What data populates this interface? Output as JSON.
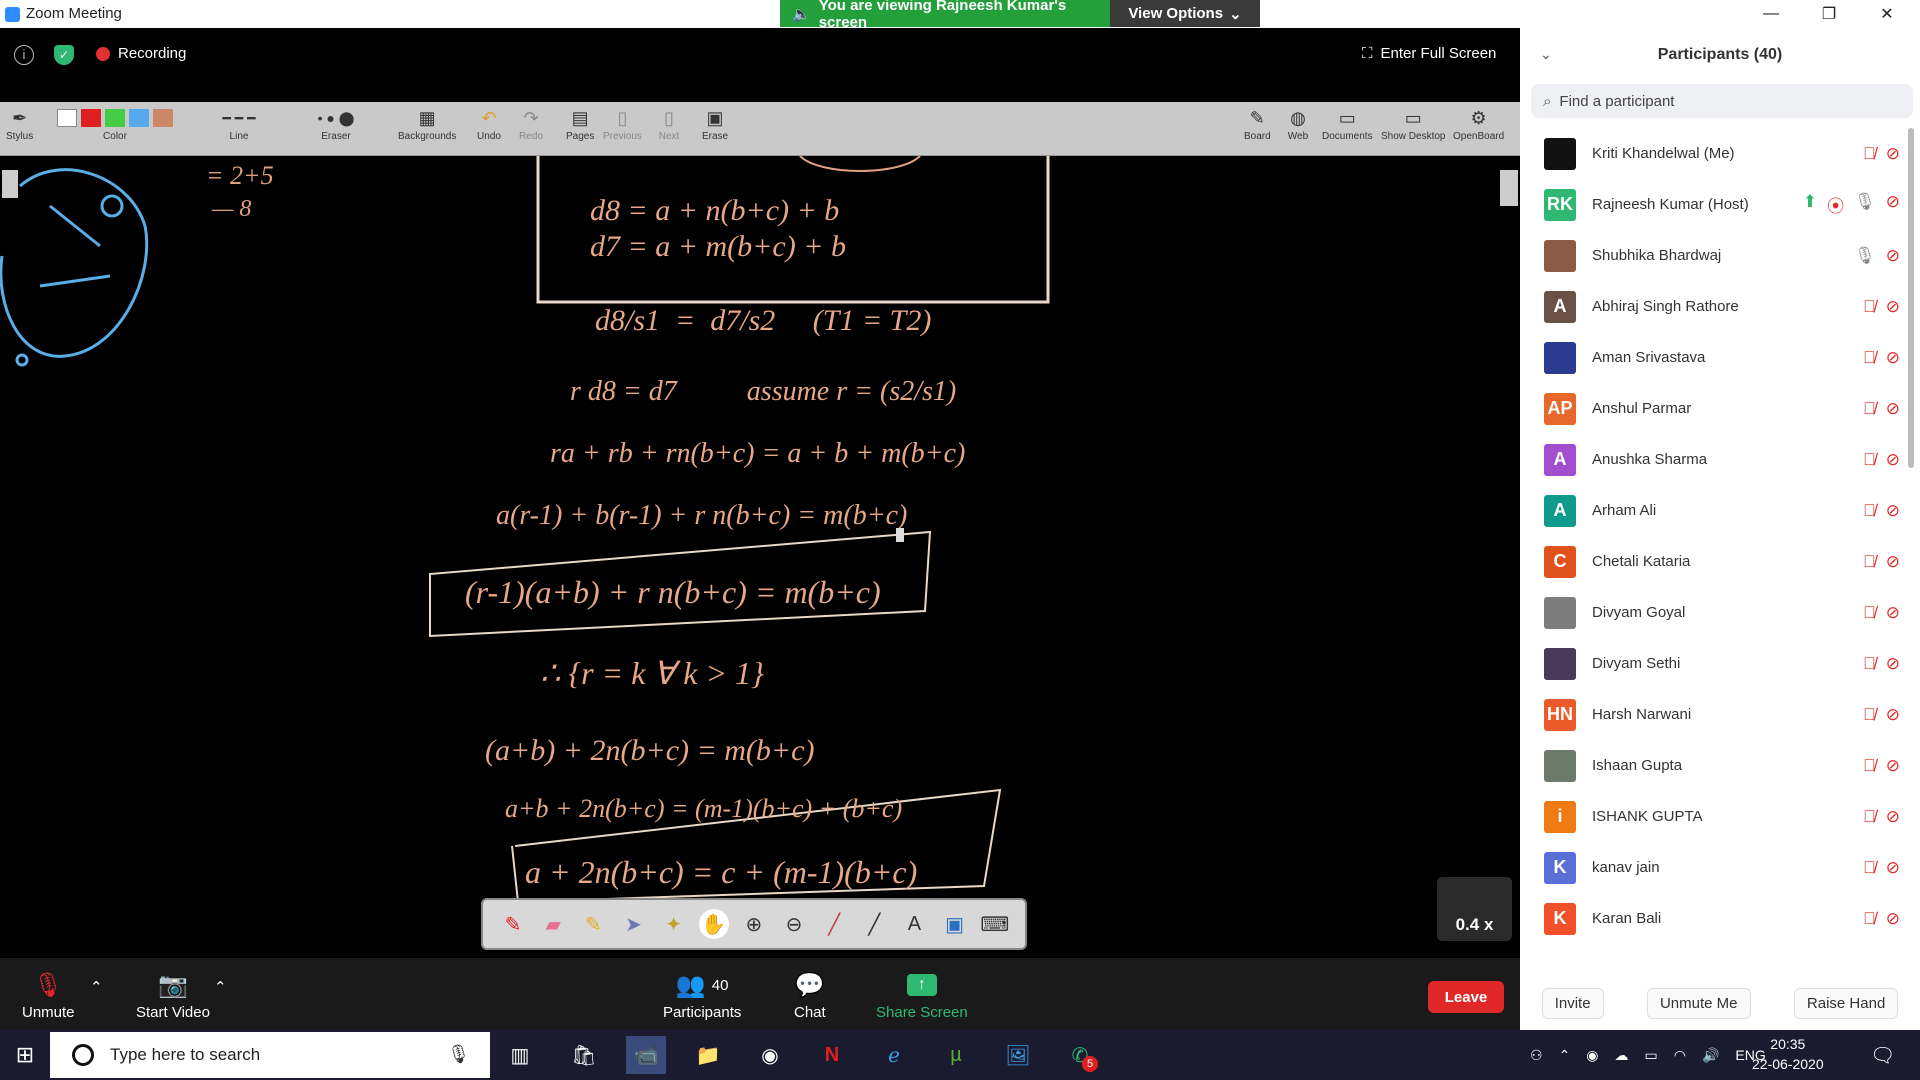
{
  "window": {
    "title": "Zoom Meeting",
    "viewing_banner": "You are viewing Rajneesh Kumar's screen",
    "view_options": "View Options"
  },
  "share_top": {
    "recording": "Recording",
    "full_screen": "Enter Full Screen"
  },
  "whiteboard_toolbar": {
    "left_tools": [
      {
        "label": "Stylus",
        "icon": "stylus-icon"
      },
      {
        "label": "Color",
        "icon": "color-swatches"
      },
      {
        "label": "Line",
        "icon": "line-width-icon"
      },
      {
        "label": "Eraser",
        "icon": "eraser-size-icon"
      },
      {
        "label": "Backgrounds",
        "icon": "backgrounds-icon"
      },
      {
        "label": "Undo",
        "icon": "undo-icon"
      },
      {
        "label": "Redo",
        "icon": "redo-icon"
      },
      {
        "label": "Pages",
        "icon": "pages-icon"
      },
      {
        "label": "Previous",
        "icon": "previous-icon"
      },
      {
        "label": "Next",
        "icon": "next-icon"
      },
      {
        "label": "Erase",
        "icon": "erase-icon"
      }
    ],
    "right_tools": [
      {
        "label": "Board",
        "icon": "board-icon"
      },
      {
        "label": "Web",
        "icon": "globe-icon"
      },
      {
        "label": "Documents",
        "icon": "folder-icon"
      },
      {
        "label": "Show Desktop",
        "icon": "desktop-icon"
      },
      {
        "label": "OpenBoard",
        "icon": "gear-icon"
      }
    ],
    "colors": [
      "#ffffff",
      "#e02020",
      "#44cc44",
      "#55aaee",
      "#cc8866"
    ]
  },
  "whiteboard": {
    "lines": [
      "d8 = a + n(b+c) + b",
      "d7 = a + m(b+c) + b",
      "d8/s1  =  d7/s2     (T1 = T2)",
      "r d8 = d7          assume r = (s2/s1)",
      "ra + rb + rn(b+c) = a + b + m(b+c)",
      "a(r-1) + b(r-1) + r n(b+c) = m(b+c)",
      "(r-1)(a+b) + r n(b+c) = m(b+c)",
      "∴ {r = k ∀ k > 1}",
      "(a+b) + 2n(b+c) = m(b+c)",
      "a+b + 2n(b+c) = (m-1)(b+c) + (b+c)",
      "a + 2n(b+c) = c + (m-1)(b+c)"
    ],
    "zoom_level": "0.4 x"
  },
  "pen_tools": [
    "pen-icon",
    "eraser-icon",
    "highlighter-icon",
    "pointer-icon",
    "laser-icon",
    "hand-icon",
    "zoom-in-icon",
    "zoom-out-icon",
    "marker-icon",
    "line-icon",
    "text-icon",
    "capture-icon",
    "keyboard-icon"
  ],
  "meeting_bar": {
    "unmute": "Unmute",
    "start_video": "Start Video",
    "participants": "Participants",
    "participants_count": "40",
    "chat": "Chat",
    "share_screen": "Share Screen",
    "leave": "Leave"
  },
  "panel": {
    "title": "Participants (40)",
    "search_placeholder": "Find a participant",
    "participants": [
      {
        "name": "Kriti Khandelwal (Me)",
        "avatar_text": "",
        "avatar_color": "#111111",
        "mic": "muted"
      },
      {
        "name": "Rajneesh Kumar (Host)",
        "avatar_text": "RK",
        "avatar_color": "#2eb872",
        "mic": "on",
        "sharing": true
      },
      {
        "name": "Shubhika Bhardwaj",
        "avatar_text": "",
        "avatar_color": "#8a5a44",
        "mic": "on"
      },
      {
        "name": "Abhiraj Singh Rathore",
        "avatar_text": "A",
        "avatar_color": "#6b5045",
        "mic": "muted"
      },
      {
        "name": "Aman Srivastava",
        "avatar_text": "",
        "avatar_color": "#2a3b8f",
        "mic": "muted"
      },
      {
        "name": "Anshul Parmar",
        "avatar_text": "AP",
        "avatar_color": "#e8672a",
        "mic": "muted"
      },
      {
        "name": "Anushka Sharma",
        "avatar_text": "A",
        "avatar_color": "#a24ccf",
        "mic": "muted"
      },
      {
        "name": "Arham Ali",
        "avatar_text": "A",
        "avatar_color": "#0f9b8e",
        "mic": "muted"
      },
      {
        "name": "Chetali Kataria",
        "avatar_text": "C",
        "avatar_color": "#e0521b",
        "mic": "muted"
      },
      {
        "name": "Divyam Goyal",
        "avatar_text": "",
        "avatar_color": "#7d7d7d",
        "mic": "muted"
      },
      {
        "name": "Divyam Sethi",
        "avatar_text": "",
        "avatar_color": "#4a3a5a",
        "mic": "muted"
      },
      {
        "name": "Harsh Narwani",
        "avatar_text": "HN",
        "avatar_color": "#ea5a2a",
        "mic": "muted"
      },
      {
        "name": "Ishaan Gupta",
        "avatar_text": "",
        "avatar_color": "#6b7a6a",
        "mic": "muted"
      },
      {
        "name": "ISHANK GUPTA",
        "avatar_text": "i",
        "avatar_color": "#f07a14",
        "mic": "muted"
      },
      {
        "name": "kanav jain",
        "avatar_text": "K",
        "avatar_color": "#5a6fd6",
        "mic": "muted"
      },
      {
        "name": "Karan Bali",
        "avatar_text": "K",
        "avatar_color": "#f0502a",
        "mic": "muted"
      }
    ],
    "footer": {
      "invite": "Invite",
      "unmute_me": "Unmute Me",
      "raise_hand": "Raise Hand"
    }
  },
  "taskbar": {
    "search_placeholder": "Type here to search",
    "apps": [
      "task-view-icon",
      "store-icon",
      "zoom-icon",
      "file-explorer-icon",
      "chrome-icon",
      "netflix-icon",
      "edge-icon",
      "torrent-icon",
      "photos-icon",
      "whatsapp-icon"
    ],
    "whatsapp_badge": "5",
    "language": "ENG",
    "time": "20:35",
    "date": "22-06-2020"
  }
}
